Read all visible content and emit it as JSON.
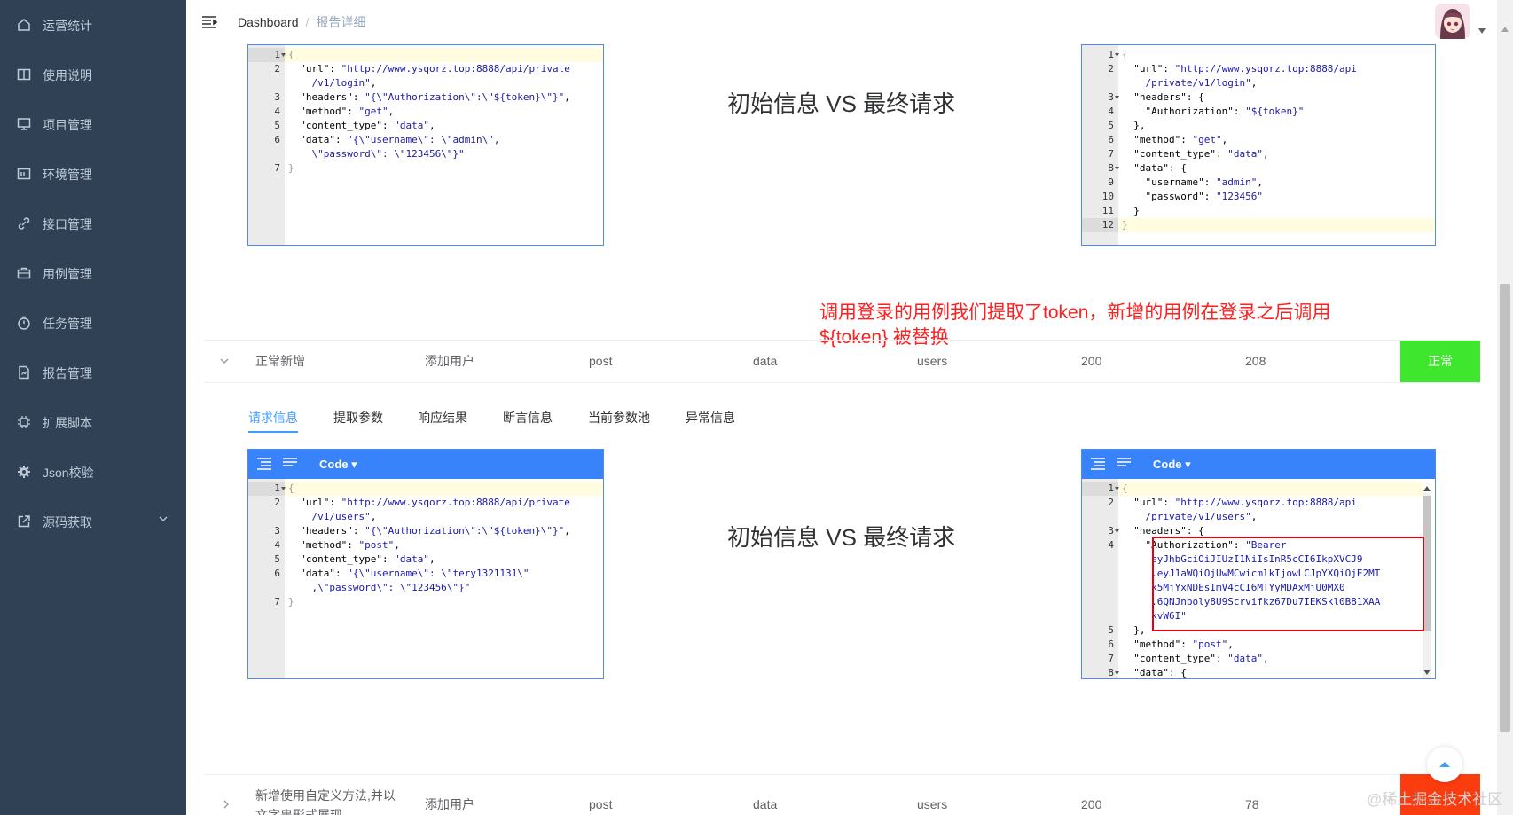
{
  "sidebar": {
    "items": [
      {
        "label": "运营统计",
        "icon": "home-icon"
      },
      {
        "label": "使用说明",
        "icon": "book-icon"
      },
      {
        "label": "项目管理",
        "icon": "monitor-icon"
      },
      {
        "label": "环境管理",
        "icon": "server-icon"
      },
      {
        "label": "接口管理",
        "icon": "link-icon"
      },
      {
        "label": "用例管理",
        "icon": "briefcase-icon"
      },
      {
        "label": "任务管理",
        "icon": "timer-icon"
      },
      {
        "label": "报告管理",
        "icon": "report-icon"
      },
      {
        "label": "扩展脚本",
        "icon": "chip-icon"
      },
      {
        "label": "Json校验",
        "icon": "gear-icon"
      },
      {
        "label": "源码获取",
        "icon": "external-link-icon"
      }
    ]
  },
  "header": {
    "breadcrumb": [
      "Dashboard",
      "报告详细"
    ],
    "separator": "/"
  },
  "editor_mode_label": "Code",
  "vs_title": "初始信息 VS 最终请求",
  "annotation": {
    "line1": "调用登录的用例我们提取了token，新增的用例在登录之后调用",
    "line2": "${token} 被替换"
  },
  "rows": [
    {
      "name": "正常新增",
      "api": "添加用户",
      "method": "post",
      "type": "data",
      "path": "users",
      "code": "200",
      "time": "208",
      "status": "正常",
      "status_color": "#3ee62e"
    },
    {
      "name_line1": "新增使用自定义方法,并以",
      "name_line2": "文字串形式展现",
      "api": "添加用户",
      "method": "post",
      "type": "data",
      "path": "users",
      "code": "200",
      "time": "78",
      "status": "",
      "status_color": "#fa3c0f"
    }
  ],
  "tabs": [
    "请求信息",
    "提取参数",
    "响应结果",
    "断言信息",
    "当前参数池",
    "异常信息"
  ],
  "editors": {
    "e1": {
      "lines": [
        {
          "n": "1",
          "fold": true,
          "t": [
            [
              "br",
              "{"
            ]
          ]
        },
        {
          "n": "2",
          "t": [
            [
              "p",
              "  "
            ],
            [
              "k",
              "\"url\""
            ],
            [
              "p",
              ": "
            ],
            [
              "s",
              "\"http://www.ysqorz.top:8888/api/private"
            ]
          ]
        },
        {
          "n": "",
          "t": [
            [
              "s",
              "    /v1/login\""
            ],
            [
              "p",
              ","
            ]
          ]
        },
        {
          "n": "3",
          "t": [
            [
              "p",
              "  "
            ],
            [
              "k",
              "\"headers\""
            ],
            [
              "p",
              ": "
            ],
            [
              "s",
              "\"{\\\"Authorization\\\":\\\"${token}\\\"}\""
            ],
            [
              "p",
              ","
            ]
          ]
        },
        {
          "n": "4",
          "t": [
            [
              "p",
              "  "
            ],
            [
              "k",
              "\"method\""
            ],
            [
              "p",
              ": "
            ],
            [
              "s",
              "\"get\""
            ],
            [
              "p",
              ","
            ]
          ]
        },
        {
          "n": "5",
          "t": [
            [
              "p",
              "  "
            ],
            [
              "k",
              "\"content_type\""
            ],
            [
              "p",
              ": "
            ],
            [
              "s",
              "\"data\""
            ],
            [
              "p",
              ","
            ]
          ]
        },
        {
          "n": "6",
          "t": [
            [
              "p",
              "  "
            ],
            [
              "k",
              "\"data\""
            ],
            [
              "p",
              ": "
            ],
            [
              "s",
              "\"{\\\"username\\\": \\\"admin\\\","
            ]
          ]
        },
        {
          "n": "",
          "t": [
            [
              "s",
              "    \\\"password\\\": \\\"123456\\\"}\""
            ]
          ]
        },
        {
          "n": "7",
          "t": [
            [
              "br",
              "}"
            ]
          ]
        }
      ]
    },
    "e2": {
      "lines": [
        {
          "n": "1",
          "fold": true,
          "t": [
            [
              "br",
              "{"
            ]
          ]
        },
        {
          "n": "2",
          "t": [
            [
              "p",
              "  "
            ],
            [
              "k",
              "\"url\""
            ],
            [
              "p",
              ": "
            ],
            [
              "s",
              "\"http://www.ysqorz.top:8888/api"
            ]
          ]
        },
        {
          "n": "",
          "t": [
            [
              "s",
              "    /private/v1/login\""
            ],
            [
              "p",
              ","
            ]
          ]
        },
        {
          "n": "3",
          "fold": true,
          "t": [
            [
              "p",
              "  "
            ],
            [
              "k",
              "\"headers\""
            ],
            [
              "p",
              ": {"
            ]
          ]
        },
        {
          "n": "4",
          "t": [
            [
              "p",
              "    "
            ],
            [
              "k",
              "\"Authorization\""
            ],
            [
              "p",
              ": "
            ],
            [
              "s",
              "\"${token}\""
            ]
          ]
        },
        {
          "n": "5",
          "t": [
            [
              "p",
              "  },"
            ]
          ]
        },
        {
          "n": "6",
          "t": [
            [
              "p",
              "  "
            ],
            [
              "k",
              "\"method\""
            ],
            [
              "p",
              ": "
            ],
            [
              "s",
              "\"get\""
            ],
            [
              "p",
              ","
            ]
          ]
        },
        {
          "n": "7",
          "t": [
            [
              "p",
              "  "
            ],
            [
              "k",
              "\"content_type\""
            ],
            [
              "p",
              ": "
            ],
            [
              "s",
              "\"data\""
            ],
            [
              "p",
              ","
            ]
          ]
        },
        {
          "n": "8",
          "fold": true,
          "t": [
            [
              "p",
              "  "
            ],
            [
              "k",
              "\"data\""
            ],
            [
              "p",
              ": {"
            ]
          ]
        },
        {
          "n": "9",
          "t": [
            [
              "p",
              "    "
            ],
            [
              "k",
              "\"username\""
            ],
            [
              "p",
              ": "
            ],
            [
              "s",
              "\"admin\""
            ],
            [
              "p",
              ","
            ]
          ]
        },
        {
          "n": "10",
          "t": [
            [
              "p",
              "    "
            ],
            [
              "k",
              "\"password\""
            ],
            [
              "p",
              ": "
            ],
            [
              "s",
              "\"123456\""
            ]
          ]
        },
        {
          "n": "11",
          "t": [
            [
              "p",
              "  }"
            ]
          ]
        },
        {
          "n": "12",
          "t": [
            [
              "br",
              "}"
            ]
          ]
        }
      ]
    },
    "e3": {
      "lines": [
        {
          "n": "1",
          "fold": true,
          "t": [
            [
              "br",
              "{"
            ]
          ]
        },
        {
          "n": "2",
          "t": [
            [
              "p",
              "  "
            ],
            [
              "k",
              "\"url\""
            ],
            [
              "p",
              ": "
            ],
            [
              "s",
              "\"http://www.ysqorz.top:8888/api/private"
            ]
          ]
        },
        {
          "n": "",
          "t": [
            [
              "s",
              "    /v1/users\""
            ],
            [
              "p",
              ","
            ]
          ]
        },
        {
          "n": "3",
          "t": [
            [
              "p",
              "  "
            ],
            [
              "k",
              "\"headers\""
            ],
            [
              "p",
              ": "
            ],
            [
              "s",
              "\"{\\\"Authorization\\\":\\\"${token}\\\"}\""
            ],
            [
              "p",
              ","
            ]
          ]
        },
        {
          "n": "4",
          "t": [
            [
              "p",
              "  "
            ],
            [
              "k",
              "\"method\""
            ],
            [
              "p",
              ": "
            ],
            [
              "s",
              "\"post\""
            ],
            [
              "p",
              ","
            ]
          ]
        },
        {
          "n": "5",
          "t": [
            [
              "p",
              "  "
            ],
            [
              "k",
              "\"content_type\""
            ],
            [
              "p",
              ": "
            ],
            [
              "s",
              "\"data\""
            ],
            [
              "p",
              ","
            ]
          ]
        },
        {
          "n": "6",
          "t": [
            [
              "p",
              "  "
            ],
            [
              "k",
              "\"data\""
            ],
            [
              "p",
              ": "
            ],
            [
              "s",
              "\"{\\\"username\\\": \\\"tery1321131\\\""
            ]
          ]
        },
        {
          "n": "",
          "t": [
            [
              "s",
              "    ,\\\"password\\\": \\\"123456\\\"}\""
            ]
          ]
        },
        {
          "n": "7",
          "t": [
            [
              "br",
              "}"
            ]
          ]
        }
      ]
    },
    "e4": {
      "lines": [
        {
          "n": "1",
          "fold": true,
          "t": [
            [
              "br",
              "{"
            ]
          ]
        },
        {
          "n": "2",
          "t": [
            [
              "p",
              "  "
            ],
            [
              "k",
              "\"url\""
            ],
            [
              "p",
              ": "
            ],
            [
              "s",
              "\"http://www.ysqorz.top:8888/api"
            ]
          ]
        },
        {
          "n": "",
          "t": [
            [
              "s",
              "    /private/v1/users\""
            ],
            [
              "p",
              ","
            ]
          ]
        },
        {
          "n": "3",
          "fold": true,
          "t": [
            [
              "p",
              "  "
            ],
            [
              "k",
              "\"headers\""
            ],
            [
              "p",
              ": {"
            ]
          ]
        },
        {
          "n": "4",
          "t": [
            [
              "p",
              "    "
            ],
            [
              "k",
              "\"Authorization\""
            ],
            [
              "p",
              ": "
            ],
            [
              "s",
              "\"Bearer"
            ]
          ]
        },
        {
          "n": "",
          "t": [
            [
              "s",
              "     eyJhbGciOiJIUzI1NiIsInR5cCI6IkpXVCJ9"
            ]
          ]
        },
        {
          "n": "",
          "t": [
            [
              "s",
              "     .eyJ1aWQiOjUwMCwicmlkIjowLCJpYXQiOjE2MT"
            ]
          ]
        },
        {
          "n": "",
          "t": [
            [
              "s",
              "     k5MjYxNDEsImV4cCI6MTYyMDAxMjU0MX0"
            ]
          ]
        },
        {
          "n": "",
          "t": [
            [
              "s",
              "     .6QNJnboly8U9Scrvifkz67Du7IEKSkl0B81XAA"
            ]
          ]
        },
        {
          "n": "",
          "t": [
            [
              "s",
              "     kvW6I\""
            ]
          ]
        },
        {
          "n": "5",
          "t": [
            [
              "p",
              "  },"
            ]
          ]
        },
        {
          "n": "6",
          "t": [
            [
              "p",
              "  "
            ],
            [
              "k",
              "\"method\""
            ],
            [
              "p",
              ": "
            ],
            [
              "s",
              "\"post\""
            ],
            [
              "p",
              ","
            ]
          ]
        },
        {
          "n": "7",
          "t": [
            [
              "p",
              "  "
            ],
            [
              "k",
              "\"content_type\""
            ],
            [
              "p",
              ": "
            ],
            [
              "s",
              "\"data\""
            ],
            [
              "p",
              ","
            ]
          ]
        },
        {
          "n": "8",
          "fold": true,
          "t": [
            [
              "p",
              "  "
            ],
            [
              "k",
              "\"data\""
            ],
            [
              "p",
              ": {"
            ]
          ]
        }
      ]
    }
  },
  "watermark": "@稀土掘金技术社区",
  "colors": {
    "sidebar_bg": "#304156",
    "sidebar_text": "#bfcbd9",
    "accent": "#409eff",
    "editor_menubar": "#3883fa",
    "annotation": "#ff1f1f",
    "status_ok": "#3ee62e",
    "status_fail": "#fa3c0f"
  }
}
